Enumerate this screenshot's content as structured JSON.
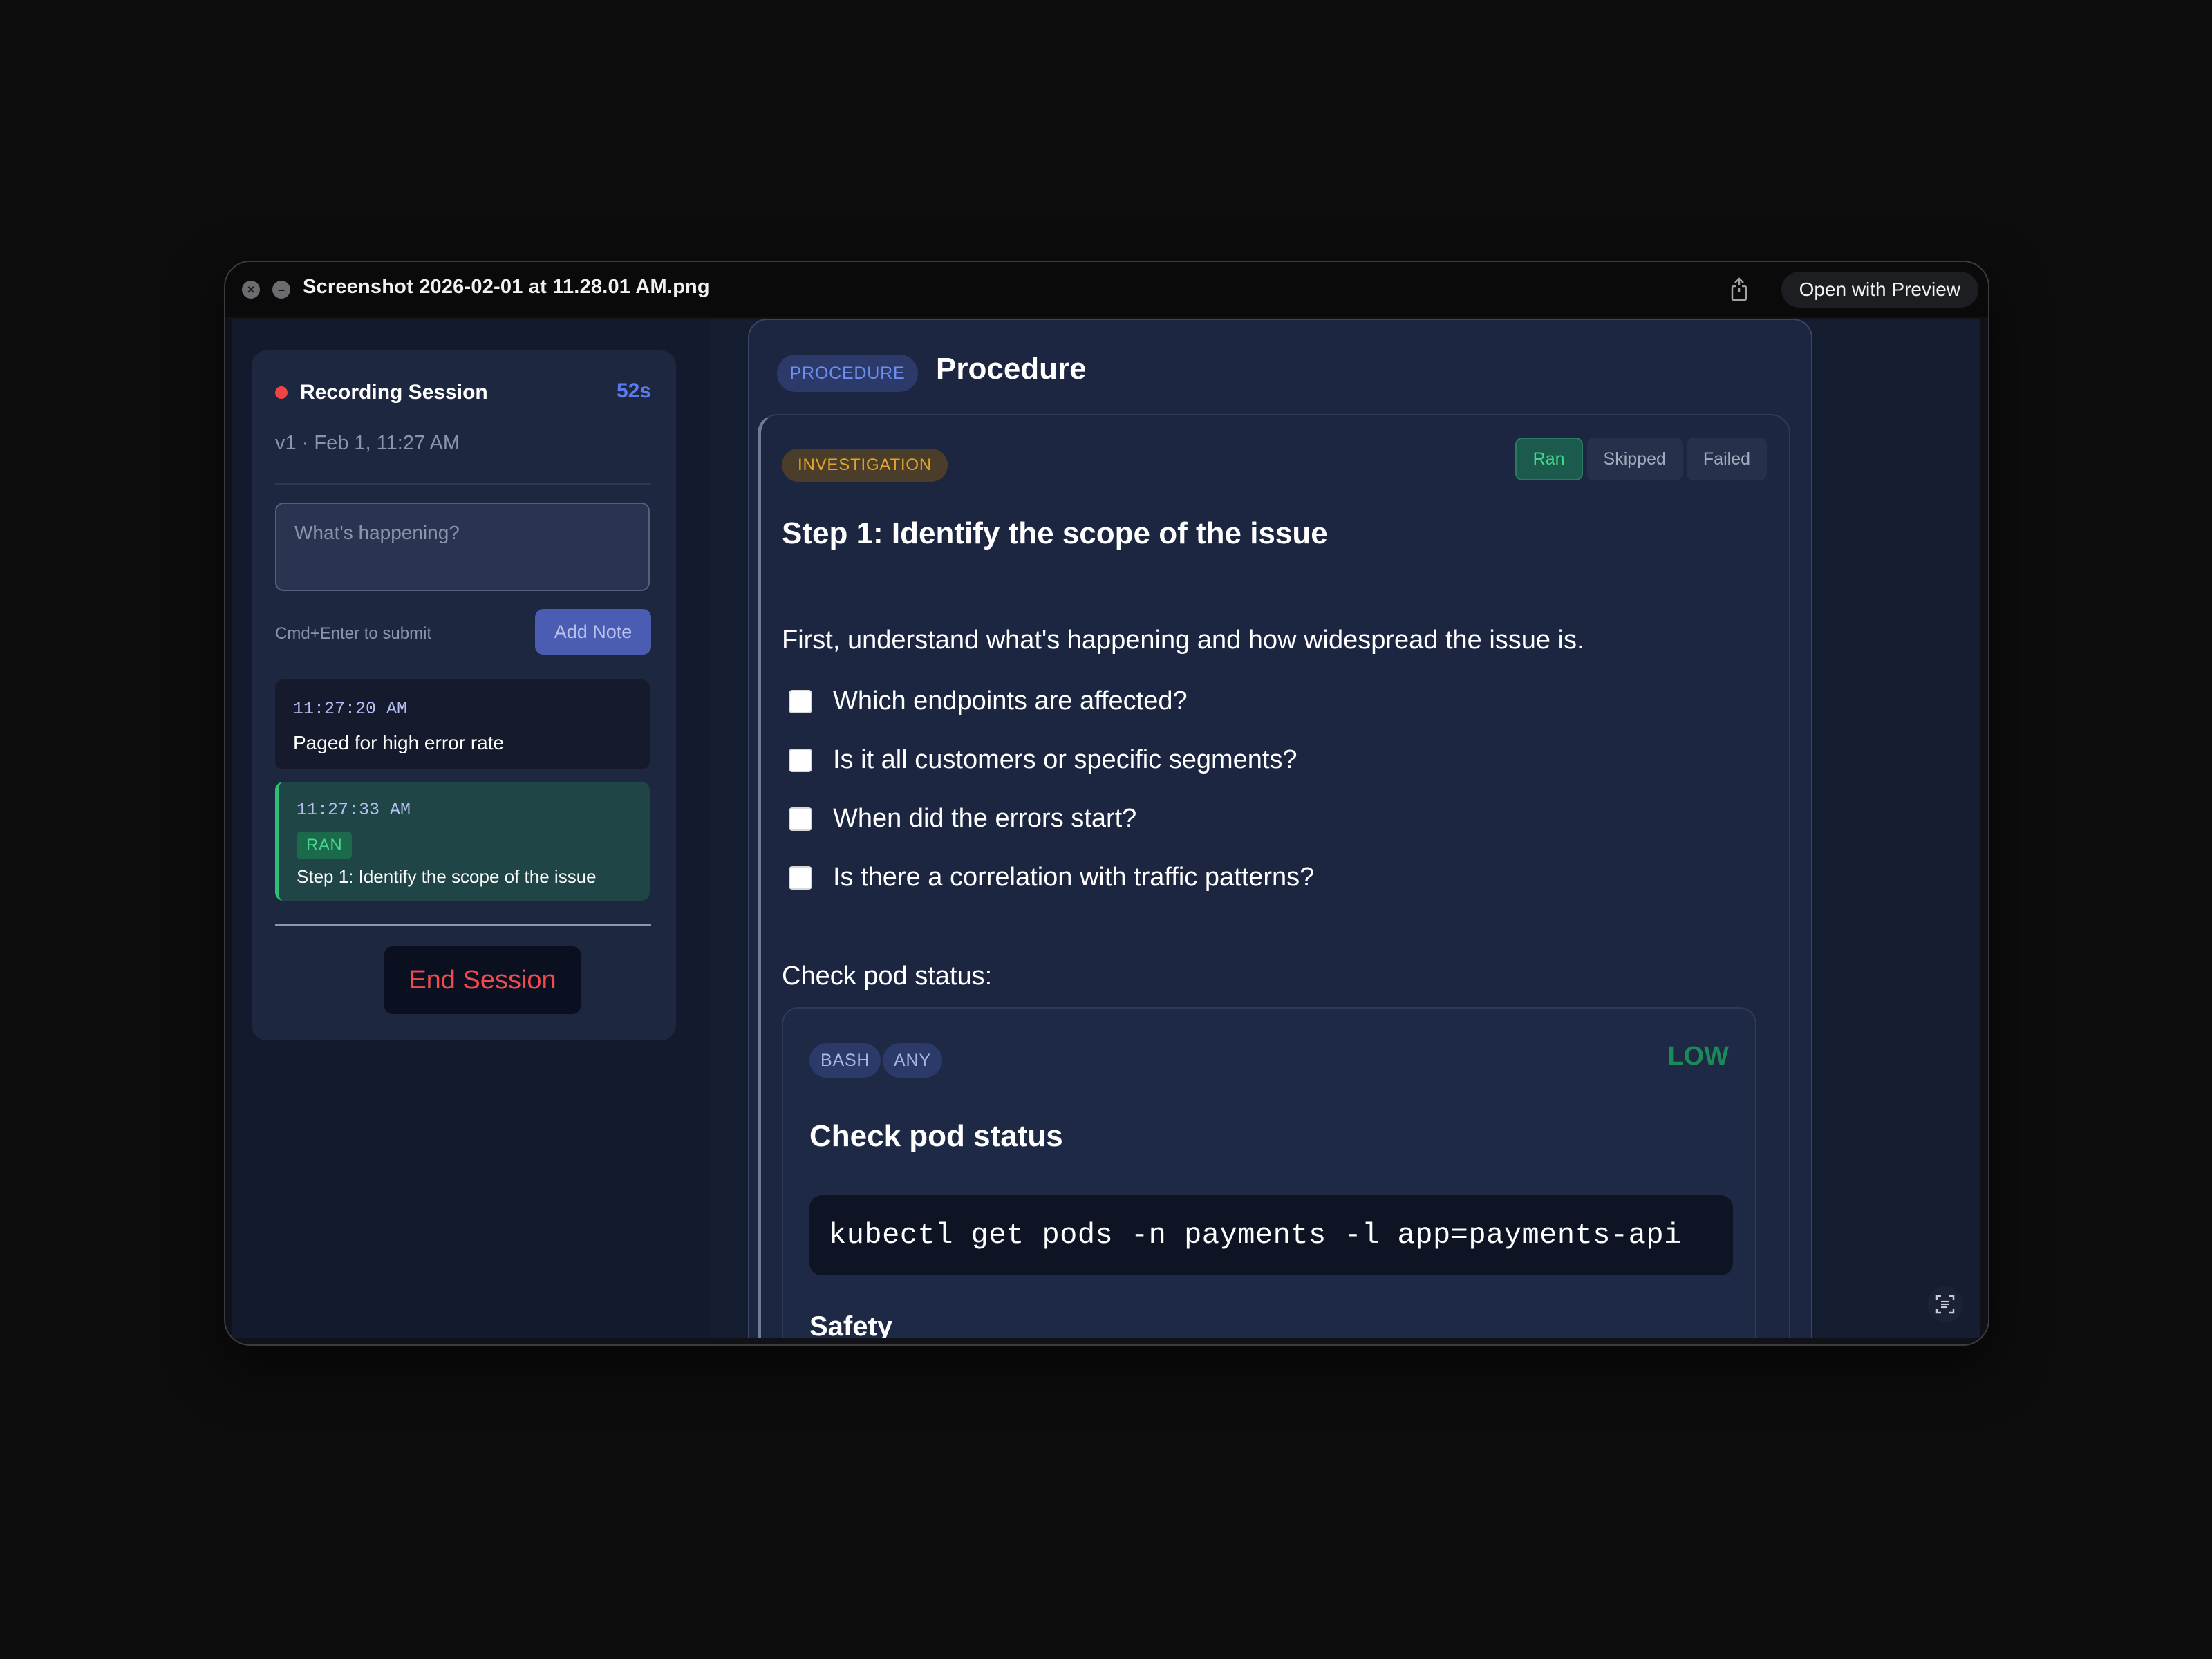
{
  "window": {
    "title": "Screenshot 2026-02-01 at 11.28.01 AM.png",
    "open_with_label": "Open with Preview",
    "icons": [
      "close-icon",
      "minimize-icon",
      "share-icon",
      "live-text-icon"
    ]
  },
  "session": {
    "title": "Recording Session",
    "elapsed": "52s",
    "version": "v1 · Feb 1, 11:27 AM",
    "note_placeholder": "What's happening?",
    "submit_hint": "Cmd+Enter to submit",
    "add_note_label": "Add Note",
    "entries": [
      {
        "time": "11:27:20 AM",
        "text": "Paged for high error rate"
      },
      {
        "time": "11:27:33 AM",
        "badge": "RAN",
        "text": "Step 1: Identify the scope of the issue"
      }
    ],
    "end_label": "End Session"
  },
  "procedure": {
    "tag": "PROCEDURE",
    "title": "Procedure",
    "step": {
      "tag": "INVESTIGATION",
      "status_options": [
        "Ran",
        "Skipped",
        "Failed"
      ],
      "selected_status": "Ran",
      "title": "Step 1: Identify the scope of the issue",
      "intro": "First, understand what's happening and how widespread the issue is.",
      "checklist": [
        "Which endpoints are affected?",
        "Is it all customers or specific segments?",
        "When did the errors start?",
        "Is there a correlation with traffic patterns?"
      ],
      "pod_label": "Check pod status:",
      "command": {
        "tags": [
          "BASH",
          "ANY"
        ],
        "risk": "LOW",
        "title": "Check pod status",
        "code": "kubectl get pods -n payments -l app=payments-api",
        "safety_heading": "Safety"
      }
    }
  },
  "colors": {
    "accent": "#5b7cf0",
    "recording_dot": "#ef4444",
    "ran_green": "#43d98a",
    "investigation_amber": "#e3a52a",
    "end_session_red": "#f04a4f",
    "low_risk_green": "#1b8a58"
  }
}
